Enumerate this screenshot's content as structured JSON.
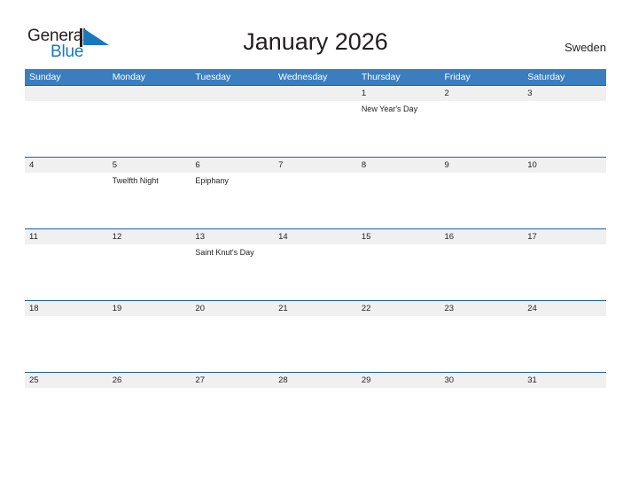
{
  "branding": {
    "logo_text_top": "General",
    "logo_text_bottom": "Blue",
    "logo_top_color": "#231f20",
    "logo_bottom_color": "#1878be",
    "flag_color": "#1878be"
  },
  "header": {
    "title": "January 2026",
    "country": "Sweden"
  },
  "colors": {
    "weekday_header_bg": "#3a7ec0",
    "weekday_header_text": "#ffffff",
    "date_band_bg": "#f0f0f0",
    "row_rule": "#1f5fa0",
    "text": "#231f20",
    "body_bg": "#ffffff"
  },
  "calendar": {
    "weekdays": [
      "Sunday",
      "Monday",
      "Tuesday",
      "Wednesday",
      "Thursday",
      "Friday",
      "Saturday"
    ],
    "weeks": [
      {
        "days": [
          {
            "date": "",
            "event": ""
          },
          {
            "date": "",
            "event": ""
          },
          {
            "date": "",
            "event": ""
          },
          {
            "date": "",
            "event": ""
          },
          {
            "date": "1",
            "event": "New Year's Day"
          },
          {
            "date": "2",
            "event": ""
          },
          {
            "date": "3",
            "event": ""
          }
        ]
      },
      {
        "days": [
          {
            "date": "4",
            "event": ""
          },
          {
            "date": "5",
            "event": "Twelfth Night"
          },
          {
            "date": "6",
            "event": "Epiphany"
          },
          {
            "date": "7",
            "event": ""
          },
          {
            "date": "8",
            "event": ""
          },
          {
            "date": "9",
            "event": ""
          },
          {
            "date": "10",
            "event": ""
          }
        ]
      },
      {
        "days": [
          {
            "date": "11",
            "event": ""
          },
          {
            "date": "12",
            "event": ""
          },
          {
            "date": "13",
            "event": "Saint Knut's Day"
          },
          {
            "date": "14",
            "event": ""
          },
          {
            "date": "15",
            "event": ""
          },
          {
            "date": "16",
            "event": ""
          },
          {
            "date": "17",
            "event": ""
          }
        ]
      },
      {
        "days": [
          {
            "date": "18",
            "event": ""
          },
          {
            "date": "19",
            "event": ""
          },
          {
            "date": "20",
            "event": ""
          },
          {
            "date": "21",
            "event": ""
          },
          {
            "date": "22",
            "event": ""
          },
          {
            "date": "23",
            "event": ""
          },
          {
            "date": "24",
            "event": ""
          }
        ]
      },
      {
        "days": [
          {
            "date": "25",
            "event": ""
          },
          {
            "date": "26",
            "event": ""
          },
          {
            "date": "27",
            "event": ""
          },
          {
            "date": "28",
            "event": ""
          },
          {
            "date": "29",
            "event": ""
          },
          {
            "date": "30",
            "event": ""
          },
          {
            "date": "31",
            "event": ""
          }
        ]
      }
    ]
  }
}
